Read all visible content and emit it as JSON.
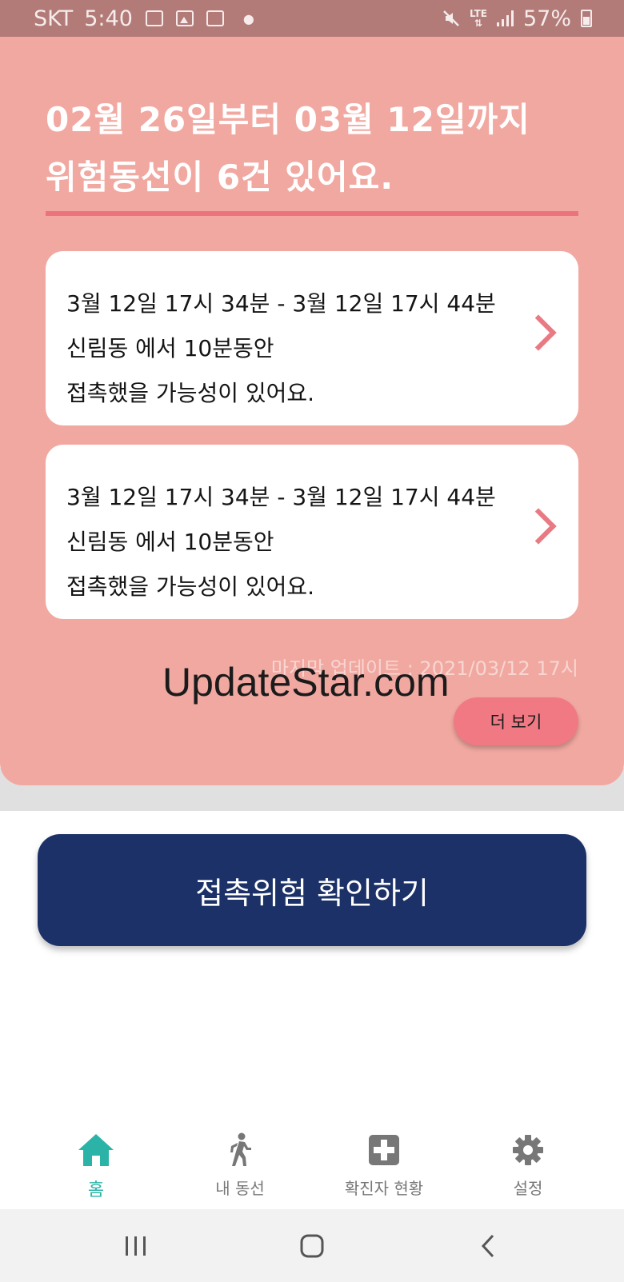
{
  "status_bar": {
    "carrier": "SKT",
    "time": "5:40",
    "network": "LTE",
    "battery": "57%"
  },
  "summary": {
    "line1": "02월 26일부터 03월 12일까지",
    "line2": "위험동선이 6건 있어요."
  },
  "contacts": [
    {
      "time_range": "3월 12일 17시 34분 - 3월 12일 17시 44분",
      "place_duration": "신림동 에서 10분동안",
      "message": "접촉했을 가능성이 있어요."
    },
    {
      "time_range": "3월 12일 17시 34분 - 3월 12일 17시 44분",
      "place_duration": "신림동 에서 10분동안",
      "message": "접촉했을 가능성이 있어요."
    }
  ],
  "last_updated": "마지막 업데이트 : 2021/03/12 17시",
  "more_button": "더 보기",
  "watermark": "UpdateStar.com",
  "check_button": "접촉위험 확인하기",
  "tabs": [
    {
      "label": "홈",
      "icon": "home-icon",
      "active": true
    },
    {
      "label": "내 동선",
      "icon": "walking-person-icon",
      "active": false
    },
    {
      "label": "확진자 현황",
      "icon": "medical-plus-icon",
      "active": false
    },
    {
      "label": "설정",
      "icon": "gear-icon",
      "active": false
    }
  ],
  "colors": {
    "hero_bg": "#f1a8a1",
    "accent_pink": "#f17983",
    "primary_navy": "#1b3167",
    "active_tab": "#2ab3a6"
  }
}
